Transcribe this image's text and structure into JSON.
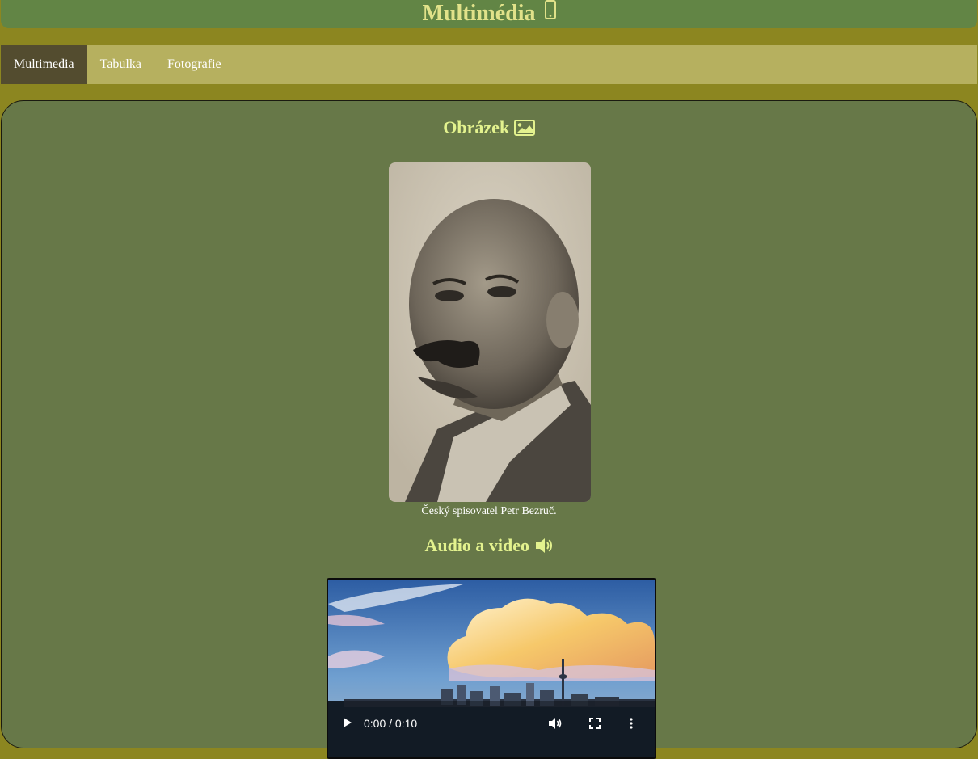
{
  "header": {
    "title": "Multimédia",
    "icon": "mobile-phone-icon"
  },
  "nav": {
    "items": [
      {
        "label": "Multimedia",
        "active": true
      },
      {
        "label": "Tabulka",
        "active": false
      },
      {
        "label": "Fotografie",
        "active": false
      }
    ]
  },
  "image_section": {
    "title": "Obrázek",
    "icon": "image-icon",
    "caption": "Český spisovatel Petr Bezruč."
  },
  "media_section": {
    "title": "Audio a video",
    "icon": "volume-icon",
    "video": {
      "time": "0:00 / 0:10",
      "icons": [
        "play-icon",
        "volume-icon",
        "fullscreen-icon",
        "more-options-icon"
      ]
    }
  },
  "colors": {
    "page_bg": "#8c8620",
    "header_bg": "#628545",
    "nav_bg": "#b6b05f",
    "nav_active": "#534c2f",
    "panel_bg": "#677848",
    "title_text": "#e3f28e"
  }
}
